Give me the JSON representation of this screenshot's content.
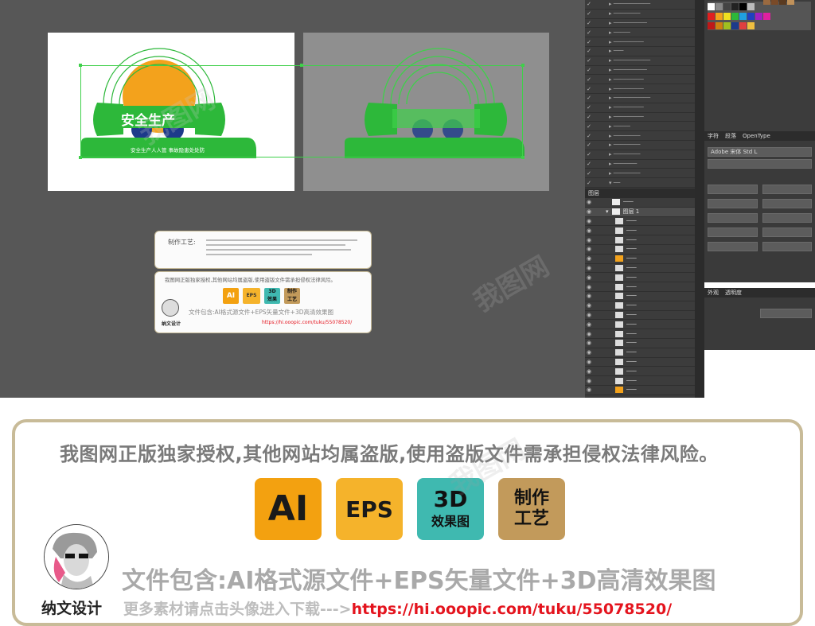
{
  "artwork": {
    "title": "安全生产",
    "subtitle": "安全生产人人管 事故隐患处处防",
    "craft_label": "制作工艺:"
  },
  "mini_notice": "我图网正版独家授权,其他网站均属盗版,使用盗版文件需承担侵权法律风险。",
  "layers_panel": {
    "tab": "图层",
    "group_name": "图层 1"
  },
  "character_panel": {
    "tabs": [
      "字符",
      "段落",
      "OpenType"
    ],
    "font": "Adobe 宋体 Std L"
  },
  "transparency_panel": {
    "tabs": [
      "外观",
      "透明度"
    ]
  },
  "colors": {
    "accent_green": "#2db83a",
    "sun_orange": "#f3a21c",
    "gear_blue": "#1d3a8a",
    "frame": "#c8bb98",
    "ai_badge": "#f3a110",
    "eps_badge": "#f5b32b",
    "3d_badge": "#3fb9b0",
    "craft_badge": "#c29a5b"
  },
  "notice": "我图网正版独家授权,其他网站均属盗版,使用盗版文件需承担侵权法律风险。",
  "badges": [
    {
      "id": "ai",
      "main": "AI",
      "sub": ""
    },
    {
      "id": "eps",
      "main": "EPS",
      "sub": ""
    },
    {
      "id": "3d",
      "main": "3D",
      "sub": "效果图"
    },
    {
      "id": "craft",
      "main": "制作",
      "sub": "工艺"
    }
  ],
  "file_contents": "文件包含:AI格式源文件+EPS矢量文件+3D高清效果图",
  "brand": "纳文设计",
  "download_prompt": "更多素材请点击头像进入下载--->",
  "link": "https://hi.ooopic.com/tuku/55078520/",
  "watermark": "我图网"
}
